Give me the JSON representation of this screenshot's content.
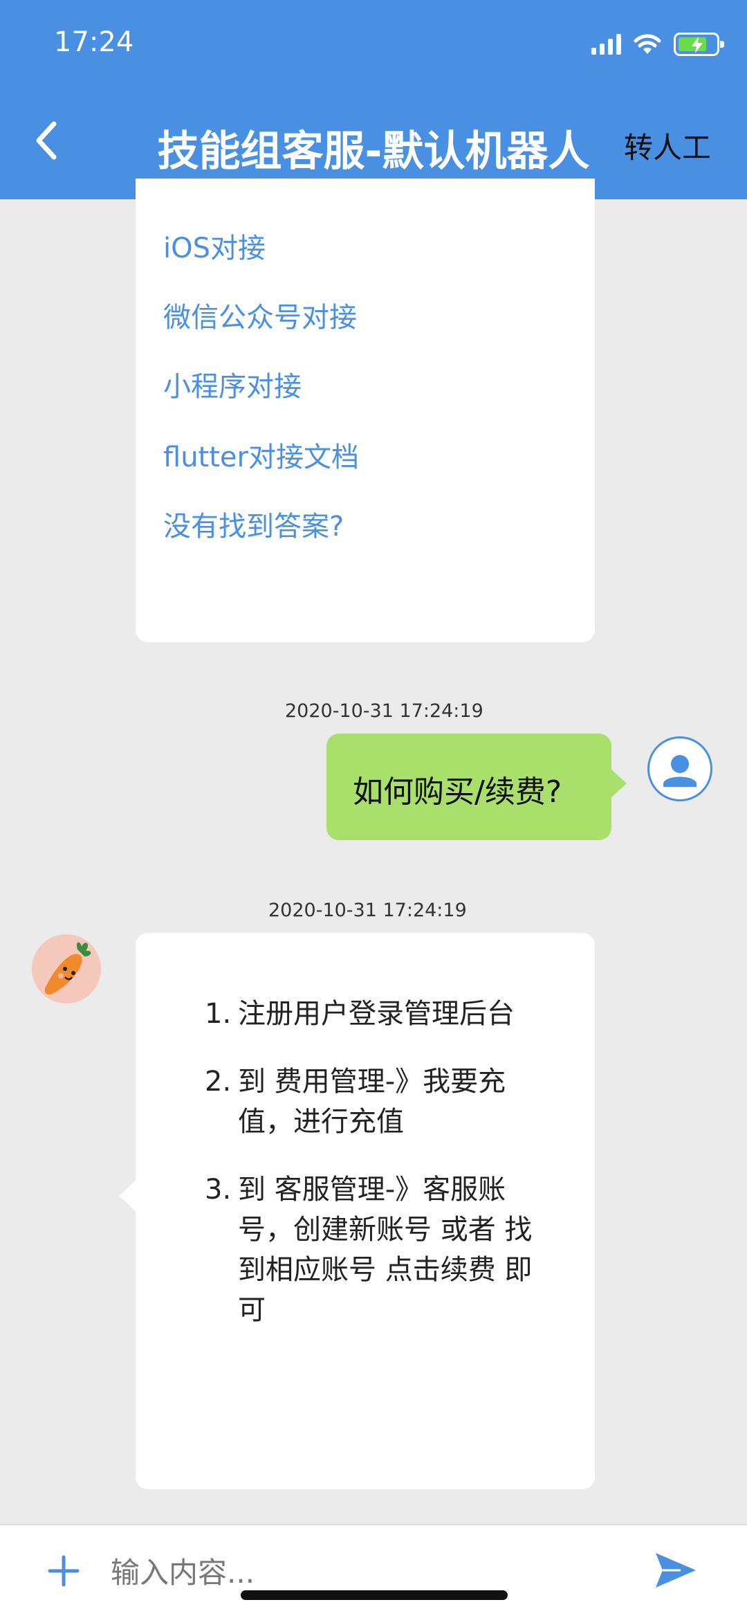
{
  "status_bar": {
    "time": "17:24"
  },
  "header": {
    "title": "技能组客服-默认机器人",
    "transfer_label": "转人工"
  },
  "faq_links": [
    "iOS对接",
    "微信公众号对接",
    "小程序对接",
    "flutter对接文档",
    "没有找到答案?"
  ],
  "messages": {
    "user": {
      "timestamp": "2020-10-31 17:24:19",
      "text": "如何购买/续费?"
    },
    "bot": {
      "timestamp": "2020-10-31 17:24:19",
      "steps": [
        {
          "num": "1.",
          "lines": [
            "注册用户登录管理后台"
          ]
        },
        {
          "num": "2.",
          "lines": [
            "到 费用管理-》我要充",
            "值，进行充值"
          ]
        },
        {
          "num": "3.",
          "lines": [
            "到 客服管理-》客服账",
            "号，创建新账号 或者 找",
            "到相应账号 点击续费 即",
            "可"
          ]
        }
      ]
    }
  },
  "input": {
    "placeholder": "输入内容..."
  },
  "colors": {
    "primary": "#4a90e2",
    "user_bubble": "#a8e06b",
    "background": "#ebebeb"
  },
  "icons": [
    "back-chevron-icon",
    "signal-icon",
    "wifi-icon",
    "battery-icon",
    "user-avatar-icon",
    "carrot-avatar-icon",
    "plus-icon",
    "send-icon"
  ]
}
